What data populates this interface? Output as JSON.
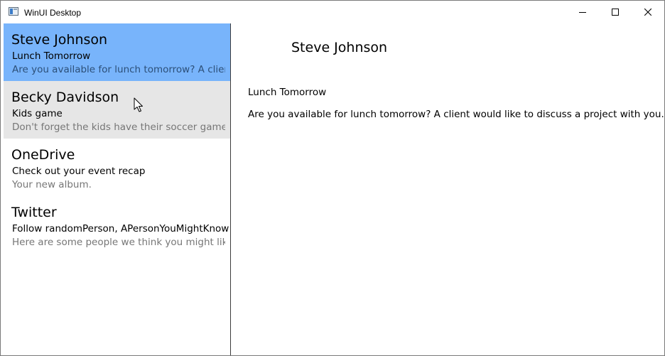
{
  "window": {
    "title": "WinUI Desktop"
  },
  "messages": [
    {
      "name": "Steve Johnson",
      "subject": "Lunch Tomorrow",
      "preview": "Are you available for lunch tomorrow? A client",
      "state": "selected"
    },
    {
      "name": "Becky Davidson",
      "subject": "Kids game",
      "preview": "Don't forget the kids have their soccer game",
      "state": "hover"
    },
    {
      "name": "OneDrive",
      "subject": "Check out your event recap",
      "preview": "Your new album.",
      "state": "normal"
    },
    {
      "name": "Twitter",
      "subject": "Follow randomPerson, APersonYouMightKnow",
      "preview": "Here are some people we think you might like",
      "state": "normal"
    }
  ],
  "detail": {
    "name": "Steve Johnson",
    "subject": "Lunch Tomorrow",
    "body": "Are you available for lunch tomorrow? A client would like to discuss a project with you."
  },
  "colors": {
    "selected_background": "#78b4fb",
    "hover_background": "#e6e6e6",
    "preview_text": "#767676"
  },
  "icons": {
    "app": "app-window-icon",
    "minimize": "minimize-icon",
    "maximize": "maximize-icon",
    "close": "close-icon",
    "cursor": "mouse-pointer-icon"
  }
}
